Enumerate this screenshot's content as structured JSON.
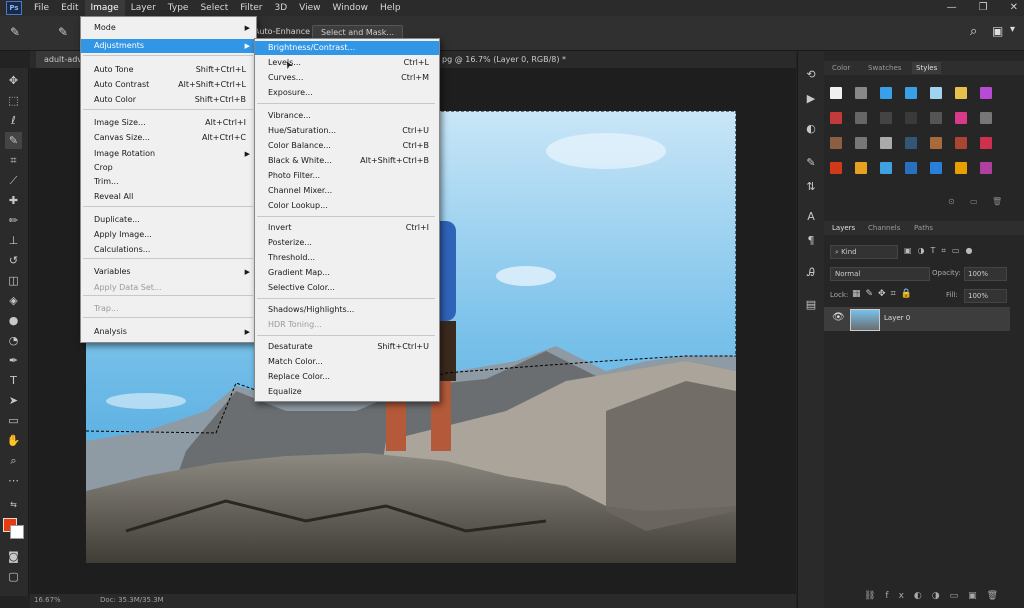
{
  "menubar": {
    "items": [
      "File",
      "Edit",
      "Image",
      "Layer",
      "Type",
      "Select",
      "Filter",
      "3D",
      "View",
      "Window",
      "Help"
    ],
    "active": "Image",
    "ps_logo": "Ps"
  },
  "window_controls": {
    "minimize": "—",
    "restore": "❐",
    "close": "✕"
  },
  "optionsbar": {
    "auto_enhance": "Auto-Enhance",
    "select_mask": "Select and Mask..."
  },
  "tabs": {
    "doc_name": "adult-adve",
    "doc_info": "pg @ 16.7% (Layer 0, RGB/8) *"
  },
  "image_menu": {
    "items": [
      {
        "label": "Mode",
        "shortcut": "",
        "submenu": true,
        "disabled": false
      },
      {
        "label": "Adjustments",
        "shortcut": "",
        "submenu": true,
        "disabled": false,
        "highlight": true
      },
      {
        "label": "Auto Tone",
        "shortcut": "Shift+Ctrl+L",
        "submenu": false,
        "disabled": false
      },
      {
        "label": "Auto Contrast",
        "shortcut": "Alt+Shift+Ctrl+L",
        "submenu": false,
        "disabled": false
      },
      {
        "label": "Auto Color",
        "shortcut": "Shift+Ctrl+B",
        "submenu": false,
        "disabled": false
      },
      {
        "label": "Image Size...",
        "shortcut": "Alt+Ctrl+I",
        "submenu": false,
        "disabled": false
      },
      {
        "label": "Canvas Size...",
        "shortcut": "Alt+Ctrl+C",
        "submenu": false,
        "disabled": false
      },
      {
        "label": "Image Rotation",
        "shortcut": "",
        "submenu": true,
        "disabled": false
      },
      {
        "label": "Crop",
        "shortcut": "",
        "submenu": false,
        "disabled": false
      },
      {
        "label": "Trim...",
        "shortcut": "",
        "submenu": false,
        "disabled": false
      },
      {
        "label": "Reveal All",
        "shortcut": "",
        "submenu": false,
        "disabled": false
      },
      {
        "label": "Duplicate...",
        "shortcut": "",
        "submenu": false,
        "disabled": false
      },
      {
        "label": "Apply Image...",
        "shortcut": "",
        "submenu": false,
        "disabled": false
      },
      {
        "label": "Calculations...",
        "shortcut": "",
        "submenu": false,
        "disabled": false
      },
      {
        "label": "Variables",
        "shortcut": "",
        "submenu": true,
        "disabled": false
      },
      {
        "label": "Apply Data Set...",
        "shortcut": "",
        "submenu": false,
        "disabled": true
      },
      {
        "label": "Trap...",
        "shortcut": "",
        "submenu": false,
        "disabled": true
      },
      {
        "label": "Analysis",
        "shortcut": "",
        "submenu": true,
        "disabled": false
      }
    ]
  },
  "adjustments_menu": {
    "items": [
      {
        "label": "Brightness/Contrast...",
        "shortcut": "",
        "highlight": true
      },
      {
        "label": "Levels...",
        "shortcut": "Ctrl+L"
      },
      {
        "label": "Curves...",
        "shortcut": "Ctrl+M"
      },
      {
        "label": "Exposure...",
        "shortcut": ""
      },
      {
        "label": "Vibrance...",
        "shortcut": ""
      },
      {
        "label": "Hue/Saturation...",
        "shortcut": "Ctrl+U"
      },
      {
        "label": "Color Balance...",
        "shortcut": "Ctrl+B"
      },
      {
        "label": "Black & White...",
        "shortcut": "Alt+Shift+Ctrl+B"
      },
      {
        "label": "Photo Filter...",
        "shortcut": ""
      },
      {
        "label": "Channel Mixer...",
        "shortcut": ""
      },
      {
        "label": "Color Lookup...",
        "shortcut": ""
      },
      {
        "label": "Invert",
        "shortcut": "Ctrl+I"
      },
      {
        "label": "Posterize...",
        "shortcut": ""
      },
      {
        "label": "Threshold...",
        "shortcut": ""
      },
      {
        "label": "Gradient Map...",
        "shortcut": ""
      },
      {
        "label": "Selective Color...",
        "shortcut": ""
      },
      {
        "label": "Shadows/Highlights...",
        "shortcut": ""
      },
      {
        "label": "HDR Toning...",
        "shortcut": "",
        "disabled": true
      },
      {
        "label": "Desaturate",
        "shortcut": "Shift+Ctrl+U"
      },
      {
        "label": "Match Color...",
        "shortcut": ""
      },
      {
        "label": "Replace Color...",
        "shortcut": ""
      },
      {
        "label": "Equalize",
        "shortcut": ""
      }
    ]
  },
  "styles_panel": {
    "tabs": [
      "Color",
      "Swatches",
      "Styles"
    ],
    "active_tab": "Styles"
  },
  "layers_panel": {
    "tabs": [
      "Layers",
      "Channels",
      "Paths"
    ],
    "active_tab": "Layers",
    "kind_filter": "Kind",
    "blend_mode": "Normal",
    "opacity_label": "Opacity:",
    "opacity_value": "100%",
    "lock_label": "Lock:",
    "fill_label": "Fill:",
    "fill_value": "100%",
    "layers": [
      {
        "name": "Layer 0",
        "visible": true
      }
    ]
  },
  "statusbar": {
    "zoom": "16.67%",
    "doc_size": "Doc: 35.3M/35.3M"
  },
  "colors": {
    "foreground": "#e83a10",
    "background": "#ffffff",
    "highlight": "#3296e6"
  }
}
